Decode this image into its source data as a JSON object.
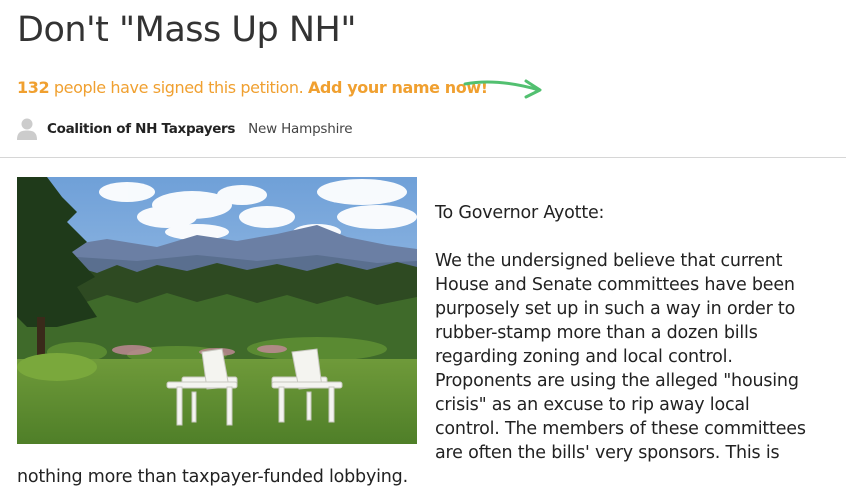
{
  "petition": {
    "title": "Don't \"Mass Up NH\"",
    "signature_count": "132",
    "signed_text": " people have signed this petition. ",
    "cta_label": "Add your name now!",
    "arrow_icon": "curved-arrow-right-icon",
    "author": {
      "avatar_icon": "user-silhouette-icon",
      "name": "Coalition of NH Taxpayers",
      "location": "New Hampshire"
    },
    "image_alt": "landscape-photo",
    "greeting": "To Governor Ayotte:",
    "body": "We the undersigned believe that current House and Senate committees have been purposely set up in such a way in order to rubber-stamp more than a dozen bills regarding zoning and local control. Proponents are using the alleged \"housing crisis\" as an excuse to rip away local control. The members of these committees are often the bills' very sponsors. This is nothing more than taxpayer-funded lobbying."
  },
  "colors": {
    "accent": "#f0a030",
    "arrow": "#52c070",
    "title": "#333333",
    "divider": "#d6d6d6"
  }
}
